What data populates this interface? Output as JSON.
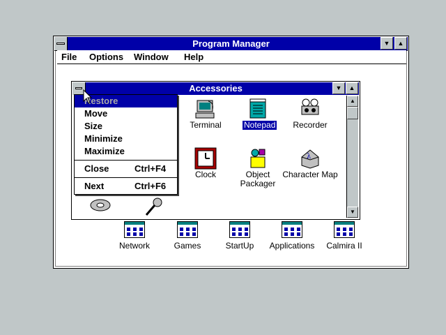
{
  "program_manager": {
    "title": "Program Manager",
    "menu": [
      "File",
      "Options",
      "Window",
      "Help"
    ],
    "groups": [
      "Network",
      "Games",
      "StartUp",
      "Applications",
      "Calmira II"
    ]
  },
  "accessories": {
    "title": "Accessories",
    "icons": [
      {
        "label": "Terminal",
        "icon": "terminal-icon",
        "selected": false
      },
      {
        "label": "Notepad",
        "icon": "notepad-icon",
        "selected": true
      },
      {
        "label": "Recorder",
        "icon": "recorder-icon",
        "selected": false
      },
      {
        "label": "Clock",
        "icon": "clock-icon",
        "selected": false
      },
      {
        "label": "Object\nPackager",
        "icon": "object-packager-icon",
        "selected": false
      },
      {
        "label": "Character Map",
        "icon": "character-map-icon",
        "selected": false
      }
    ]
  },
  "system_menu": {
    "items": [
      {
        "label": "Restore",
        "shortcut": "",
        "disabled": true,
        "highlighted": true
      },
      {
        "label": "Move",
        "shortcut": ""
      },
      {
        "label": "Size",
        "shortcut": ""
      },
      {
        "label": "Minimize",
        "shortcut": ""
      },
      {
        "label": "Maximize",
        "shortcut": ""
      },
      {
        "label": "Close",
        "shortcut": "Ctrl+F4"
      },
      {
        "label": "Next",
        "shortcut": "Ctrl+F6"
      }
    ]
  },
  "colors": {
    "desktop": "#c0c7c8",
    "titlebar_active": "#0000a8",
    "window_bg": "#ffffff"
  }
}
